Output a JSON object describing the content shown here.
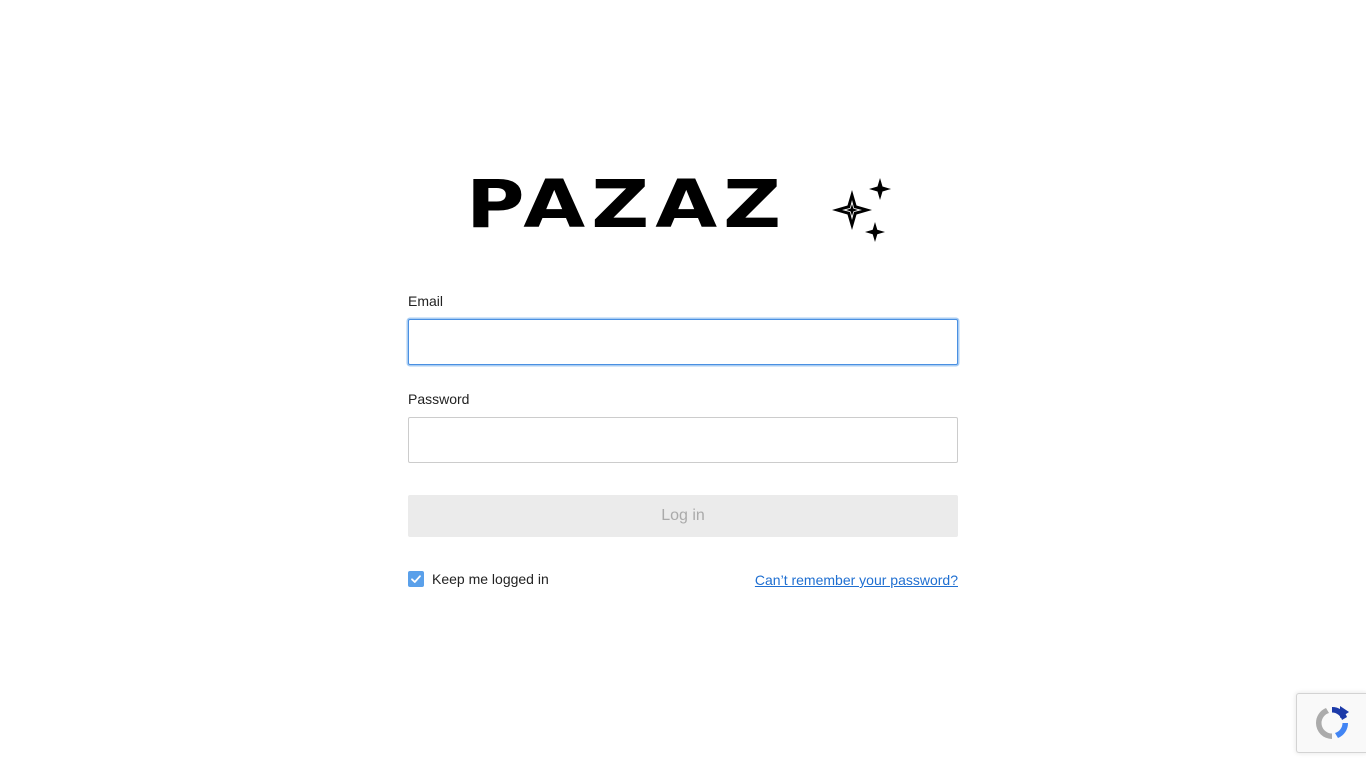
{
  "brand": {
    "logo_text": "PAZAZ",
    "logo_color": "#000000"
  },
  "form": {
    "email_label": "Email",
    "email_value": "",
    "password_label": "Password",
    "password_value": "",
    "login_button_label": "Log in",
    "keep_logged_in_label": "Keep me logged in",
    "keep_logged_in_checked": true,
    "forgot_password_link": "Can’t remember your password?"
  },
  "colors": {
    "focus_border": "#4a90e2",
    "checkbox": "#5aa0ea",
    "link": "#1f6fd1",
    "button_disabled_bg": "#ebebeb",
    "button_disabled_text": "#aaaaaa"
  },
  "icons": {
    "logo_decoration": "sparkles-icon",
    "checkbox_mark": "check-icon",
    "recaptcha_badge": "recaptcha-icon"
  }
}
